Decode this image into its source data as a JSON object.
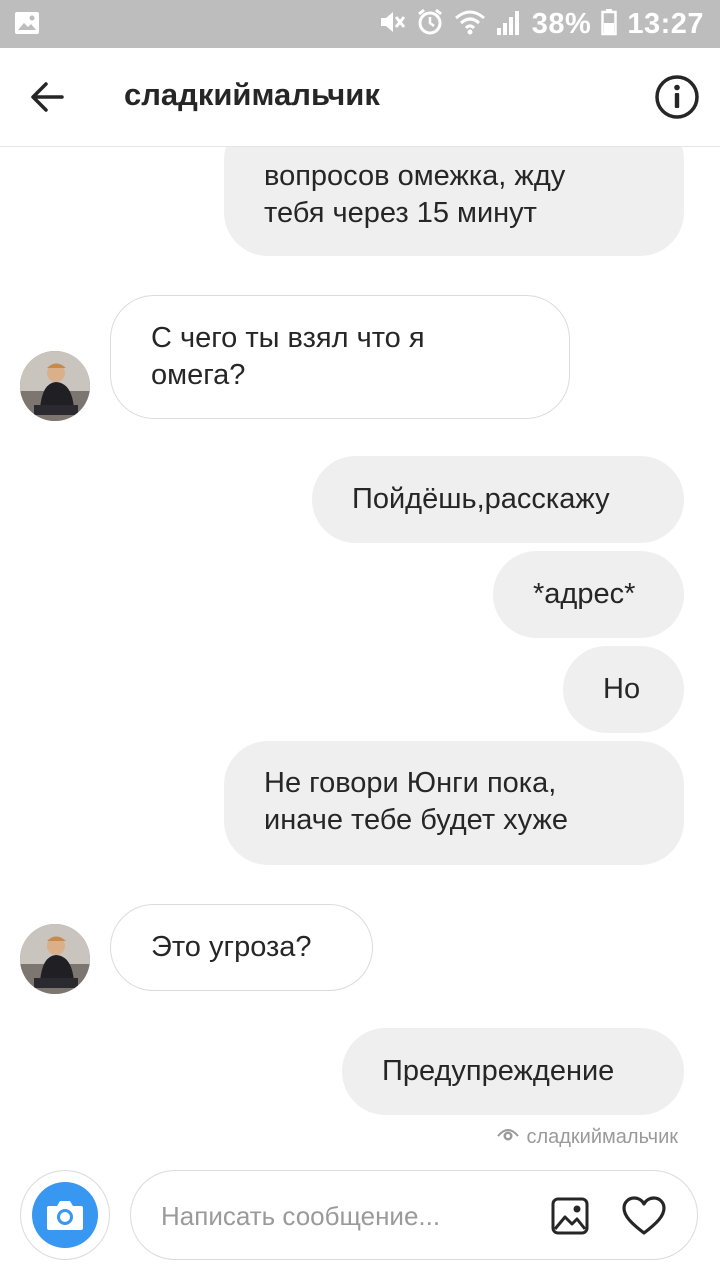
{
  "status_bar": {
    "battery": "38%",
    "time": "13:27",
    "icons": [
      "image-icon",
      "mute-icon",
      "alarm-icon",
      "wifi-icon",
      "signal-icon",
      "battery-icon"
    ]
  },
  "header": {
    "title": "сладкиймальчик",
    "back_icon": "arrow-left-icon",
    "info_icon": "info-icon"
  },
  "messages": [
    {
      "direction": "out",
      "lines": [
        "вопросов омежка, жду",
        "тебя через 15 минут"
      ]
    },
    {
      "direction": "in",
      "lines": [
        "С чего ты взял что я",
        "омега?"
      ]
    },
    {
      "direction": "out",
      "lines": [
        "Пойдёшь,расскажу"
      ]
    },
    {
      "direction": "out",
      "lines": [
        "*адрес*"
      ]
    },
    {
      "direction": "out",
      "lines": [
        "Но"
      ]
    },
    {
      "direction": "out",
      "lines": [
        "Не говори Юнги пока,",
        "иначе тебе будет хуже"
      ]
    },
    {
      "direction": "in",
      "lines": [
        "Это угроза?"
      ]
    },
    {
      "direction": "out",
      "lines": [
        "Предупреждение"
      ]
    }
  ],
  "seen": {
    "label": "сладкиймальчик",
    "icon": "eye-icon"
  },
  "composer": {
    "placeholder": "Написать сообщение...",
    "value": "",
    "camera_icon": "camera-icon",
    "gallery_icon": "gallery-icon",
    "like_icon": "heart-icon"
  },
  "colors": {
    "accent": "#3897f0",
    "outgoing_bubble": "#efefef",
    "incoming_border": "#dbdbdb",
    "status_bar": "#bdbdbd"
  }
}
